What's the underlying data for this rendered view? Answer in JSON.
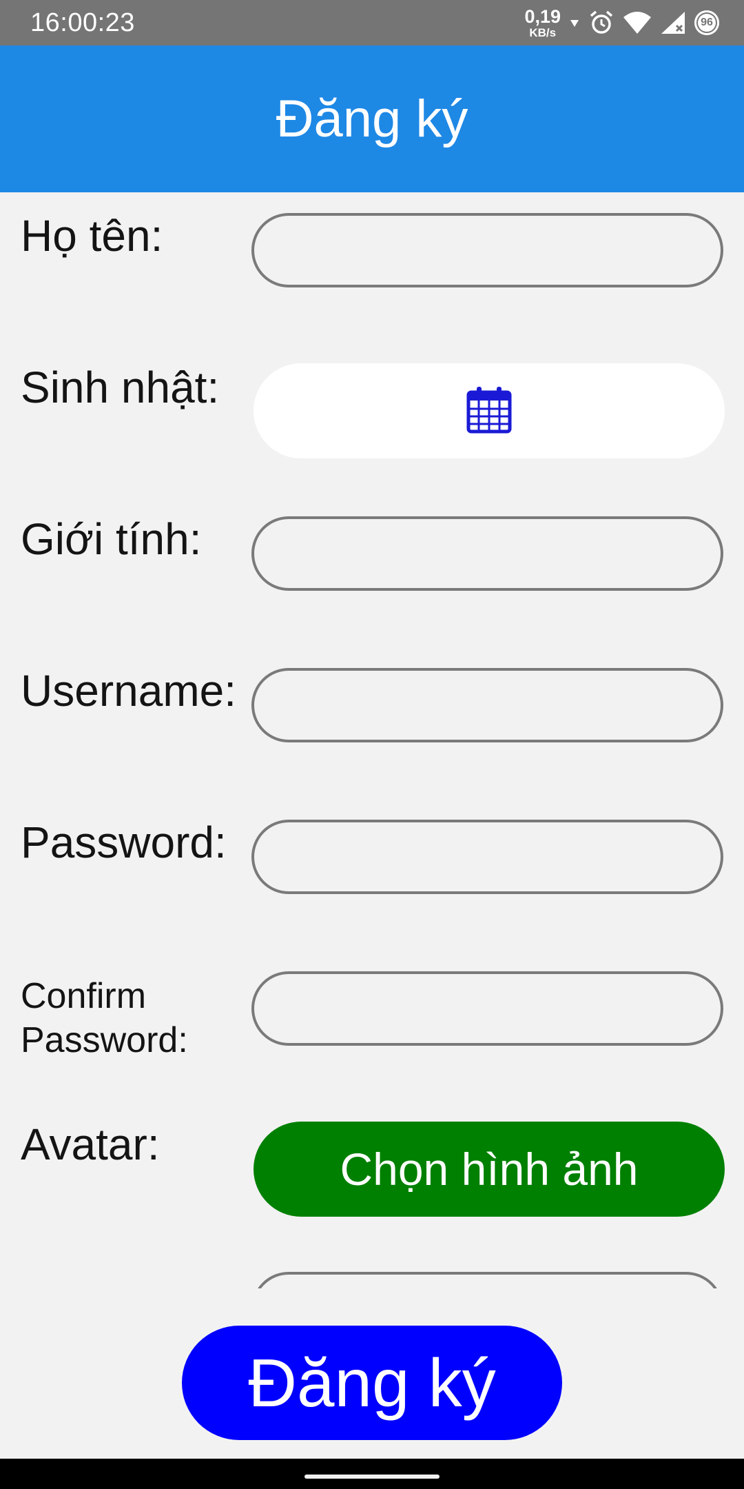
{
  "status_bar": {
    "time": "16:00:23",
    "net_speed_value": "0,19",
    "net_speed_unit": "KB/s",
    "battery_level": "96",
    "icons": [
      "data-arrow-icon",
      "alarm-icon",
      "wifi-icon",
      "signal-no-data-icon",
      "battery-icon"
    ]
  },
  "app_bar": {
    "title": "Đăng ký",
    "color": "#1e88e5"
  },
  "form": {
    "full_name": {
      "label": "Họ tên:",
      "value": ""
    },
    "birthday": {
      "label": "Sinh nhật:",
      "icon": "calendar-icon"
    },
    "gender": {
      "label": "Giới tính:",
      "value": ""
    },
    "username": {
      "label": "Username:",
      "value": ""
    },
    "password": {
      "label": "Password:",
      "value": ""
    },
    "confirm_password": {
      "label_line1": "Confirm",
      "label_line2": "Password:",
      "value": ""
    },
    "avatar": {
      "label": "Avatar:",
      "button_label": "Chọn hình ảnh",
      "button_color": "#008000"
    }
  },
  "submit": {
    "label": "Đăng ký",
    "color": "#0000ff"
  }
}
